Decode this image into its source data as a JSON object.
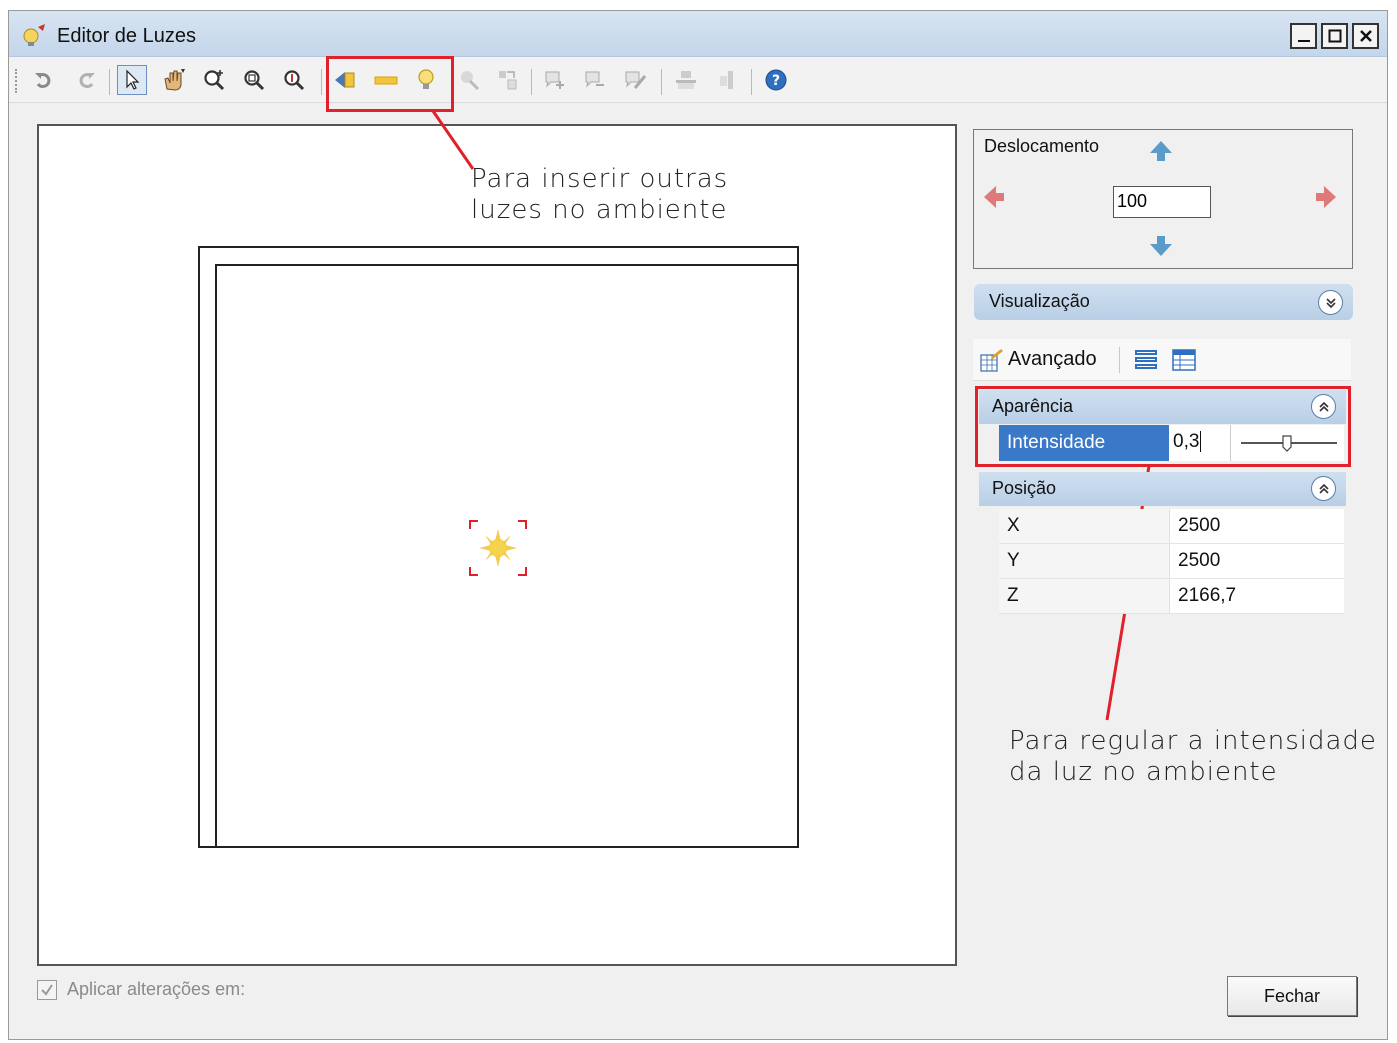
{
  "window": {
    "title": "Editor de Luzes",
    "minimize_icon": "minimize-icon",
    "maximize_icon": "maximize-icon",
    "close_icon": "close-icon"
  },
  "toolbar": {
    "icons": [
      "undo-icon",
      "redo-icon",
      "select-pointer-icon",
      "pan-hand-icon",
      "zoom-in-icon",
      "zoom-window-icon",
      "zoom-extents-icon",
      "spot-light-icon",
      "linear-light-icon",
      "point-light-icon",
      "light-disabled-icon",
      "align-icon",
      "add-light-icon",
      "remove-light-icon",
      "erase-icon",
      "align-top-icon",
      "align-side-icon",
      "help-icon"
    ]
  },
  "annotations": {
    "top": {
      "line1": "Para inserir outras",
      "line2": "luzes no ambiente"
    },
    "bottom": {
      "line1": "Para regular a intensidade",
      "line2": "da luz no ambiente"
    },
    "color": "#e0202a"
  },
  "deslocamento": {
    "label": "Deslocamento",
    "value": "100"
  },
  "visualizacao": {
    "label": "Visualização"
  },
  "tabs": {
    "advanced_label": "Avançado"
  },
  "aparencia": {
    "label": "Aparência",
    "intensidade_label": "Intensidade",
    "intensidade_value": "0,3"
  },
  "posicao": {
    "label": "Posição",
    "rows": [
      {
        "key": "X",
        "value": "2500"
      },
      {
        "key": "Y",
        "value": "2500"
      },
      {
        "key": "Z",
        "value": "2166,7"
      }
    ]
  },
  "footer": {
    "apply_label": "Aplicar alterações em:",
    "close_label": "Fechar"
  },
  "colors": {
    "accent": "#3a78c8",
    "titlebar": "#c4d6ea",
    "annotation": "#e0202a"
  }
}
